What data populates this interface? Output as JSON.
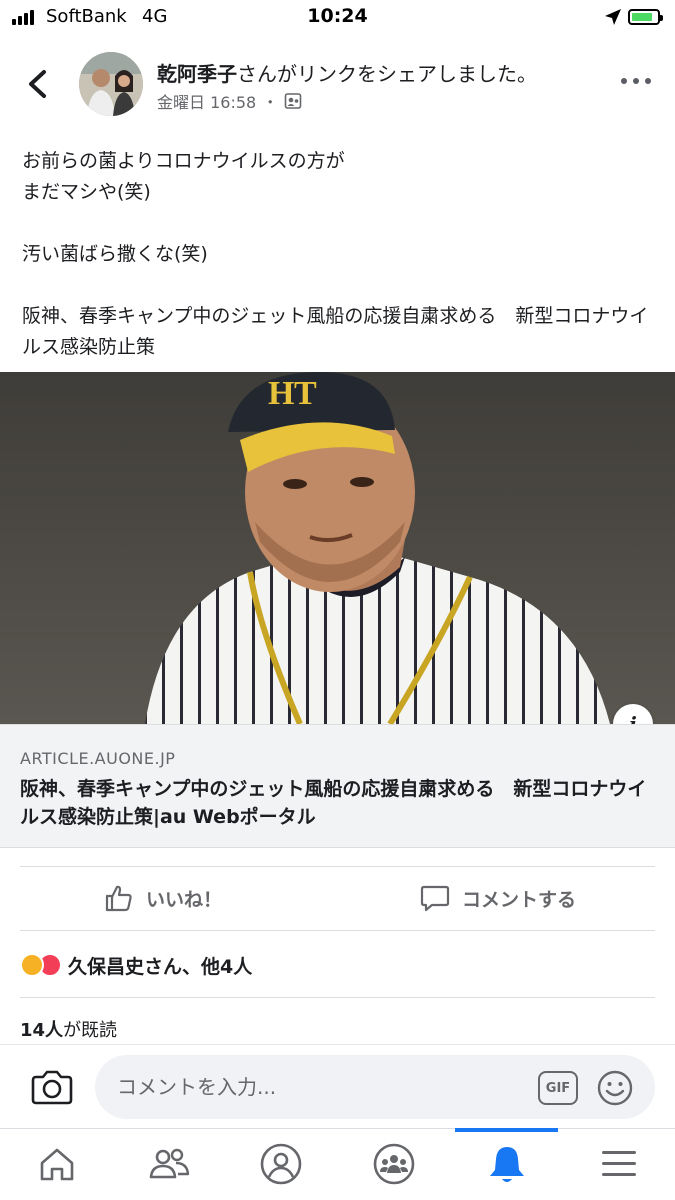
{
  "status_bar": {
    "carrier": "SoftBank",
    "network": "4G",
    "time": "10:24"
  },
  "post": {
    "author": "乾阿季子",
    "action_text": "さんがリンクをシェアしました。",
    "timestamp": "金曜日 16:58",
    "separator": "・",
    "text_lines": [
      "お前らの菌よりコロナウイルスの方が",
      "まだマシや(笑)",
      "汚い菌ばら撒くな(笑)",
      "阪神、春季キャンプ中のジェット風船の応援自粛求める　新型コロナウイルス感染防止策"
    ]
  },
  "link": {
    "domain": "ARTICLE.AUONE.JP",
    "title": "阪神、春季キャンプ中のジェット風船の応援自粛求める　新型コロナウイルス感染防止策|au Webポータル",
    "info_label": "i"
  },
  "actions": {
    "like_label": "いいね！",
    "comment_label": "コメントする"
  },
  "reactions": {
    "text": "久保昌史さん、他4人"
  },
  "seen": {
    "count": "14人",
    "suffix": "が既読"
  },
  "comment_box": {
    "placeholder": "コメントを入力...",
    "gif_label": "GIF"
  },
  "bottom_nav": {
    "active_index": 4
  },
  "colors": {
    "accent": "#1877f2",
    "muted": "#65676b",
    "text": "#1c1e21"
  }
}
